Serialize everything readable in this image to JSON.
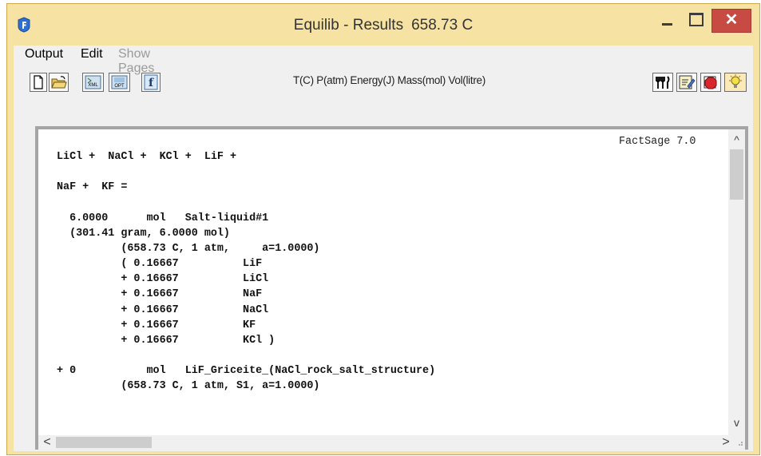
{
  "window": {
    "title": "Equilib - Results",
    "temperature": "658.73 C",
    "close_glyph": "✕"
  },
  "menu": {
    "output": "Output",
    "edit": "Edit",
    "show_pages": "Show Pages"
  },
  "toolbar": {
    "units": "T(C) P(atm) Energy(J) Mass(mol) Vol(litre)",
    "left_icons": [
      "new-document-icon",
      "open-folder-icon",
      "xml-icon",
      "options-icon",
      "function-icon"
    ],
    "right_icons": [
      "utensils-icon",
      "edit-note-icon",
      "stop-sign-icon",
      "bulb-icon"
    ]
  },
  "results": {
    "factsage_label": "FactSage 7.0",
    "lines": [
      "LiCl +  NaCl +  KCl +  LiF +",
      "",
      "NaF +  KF =",
      "",
      "  6.0000      mol   Salt-liquid#1",
      "  (301.41 gram, 6.0000 mol)",
      "          (658.73 C, 1 atm,     a=1.0000)",
      "          ( 0.16667          LiF",
      "          + 0.16667          LiCl",
      "          + 0.16667          NaF",
      "          + 0.16667          NaCl",
      "          + 0.16667          KF",
      "          + 0.16667          KCl )",
      "",
      "+ 0           mol   LiF_Griceite_(NaCl_rock_salt_structure)",
      "          (658.73 C, 1 atm, S1, a=1.0000)"
    ]
  },
  "scrollbars": {
    "up": "^",
    "down": "v",
    "left": "<",
    "right": ">"
  },
  "colors": {
    "title_bar": "#f6e3a4",
    "close_button": "#c74a43",
    "client_background": "#f0f0f0",
    "results_background": "#ffffff"
  }
}
